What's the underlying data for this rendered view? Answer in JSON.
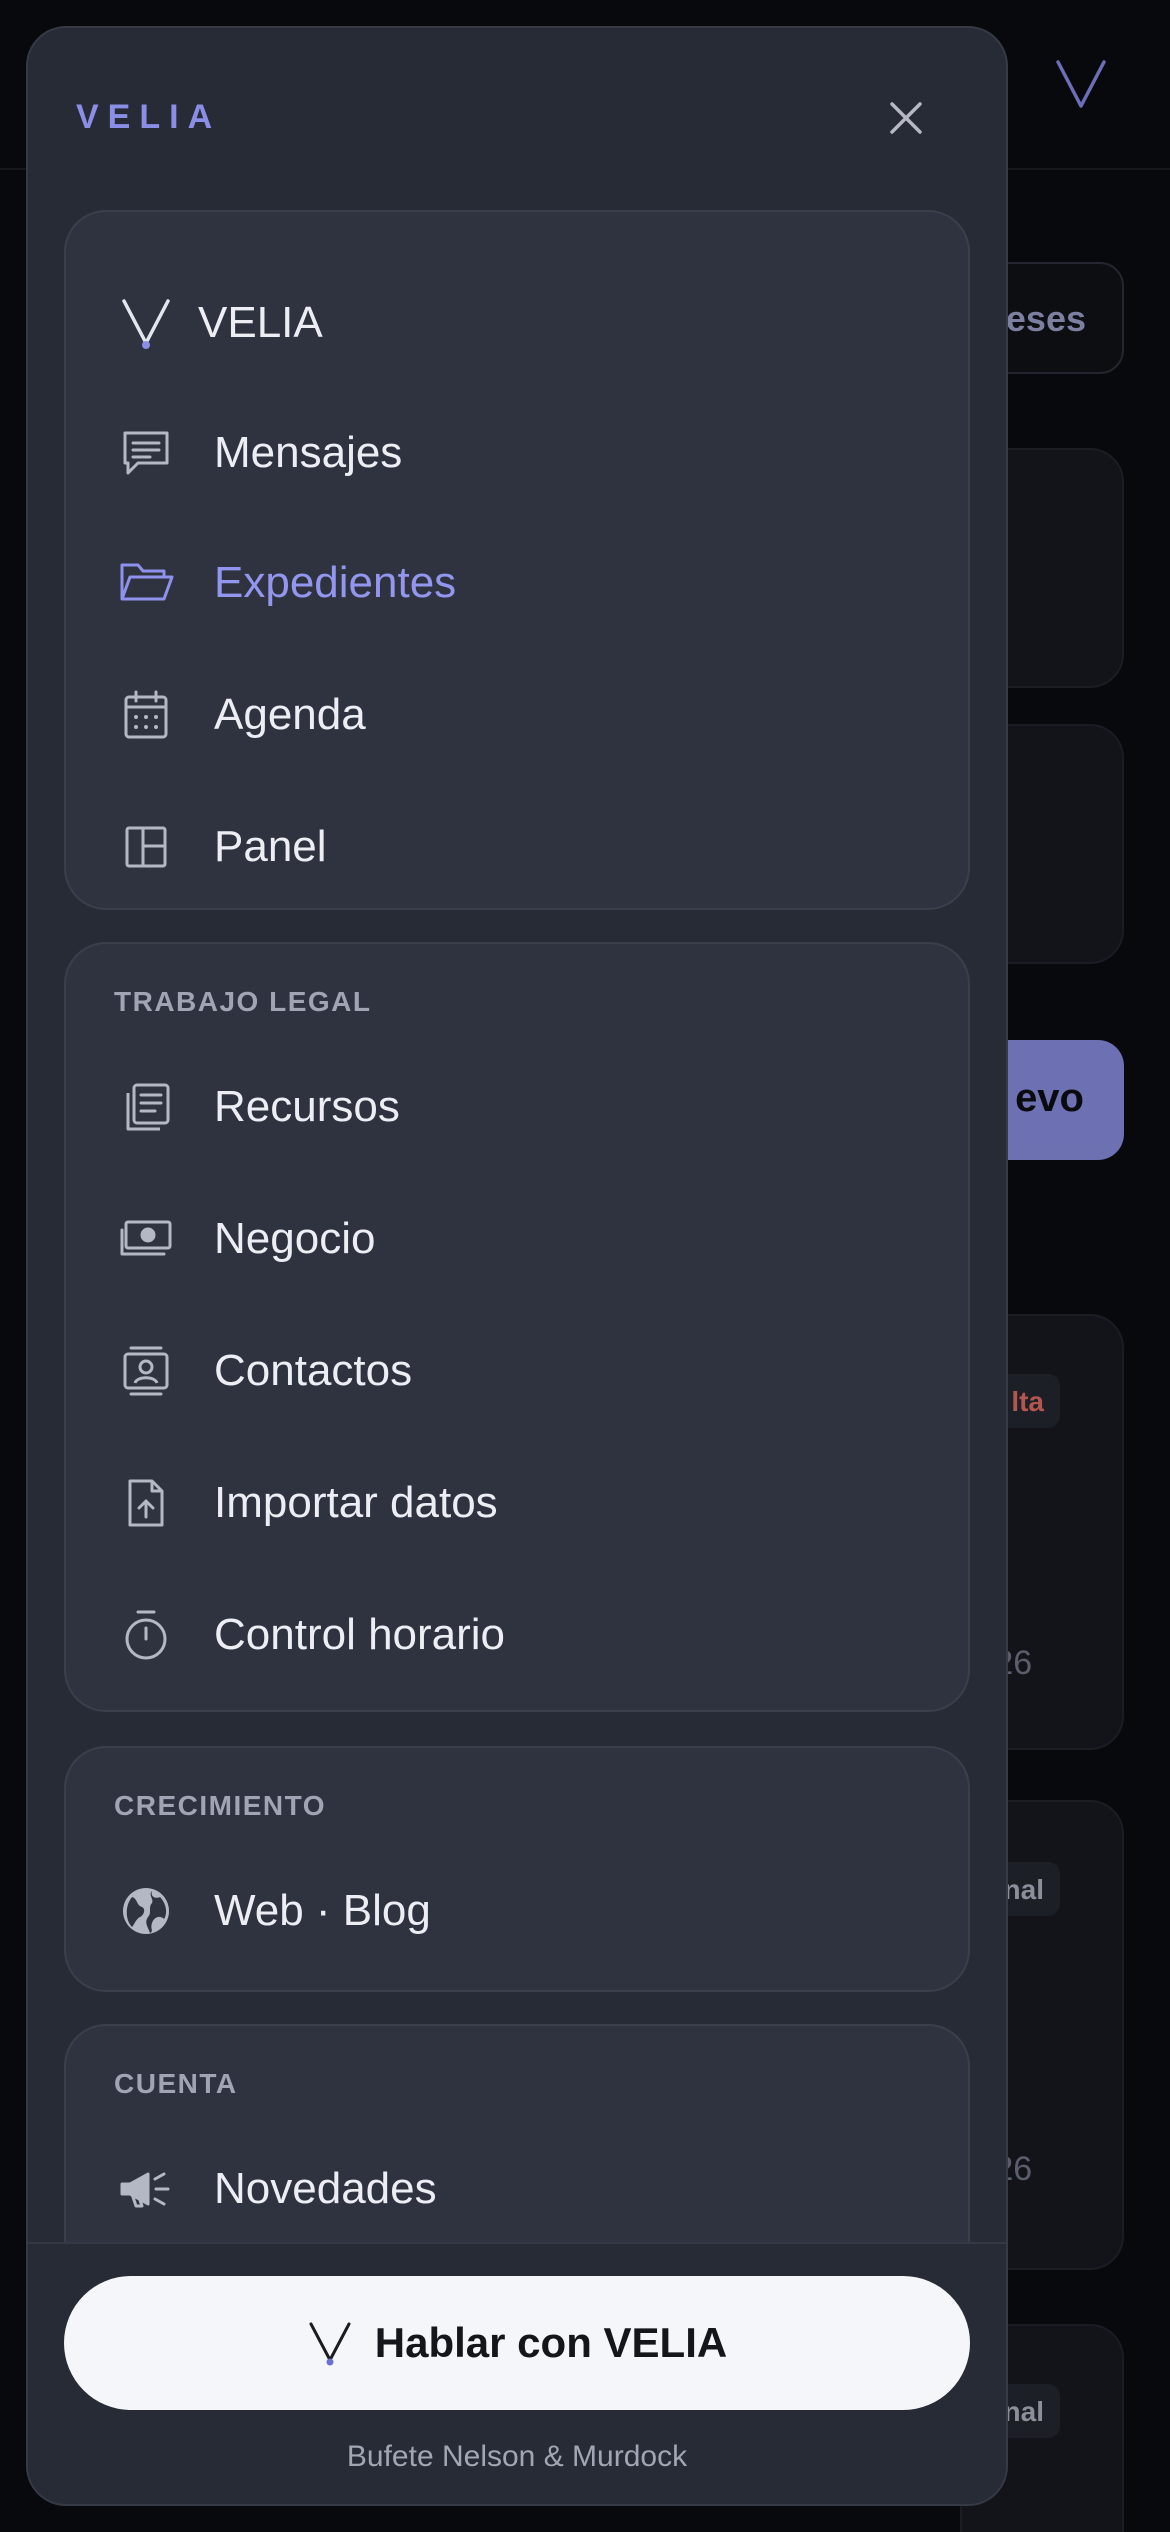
{
  "background": {
    "pill_label": "eses",
    "new_button_label": "evo",
    "cards": [
      {
        "badge": "lta",
        "badge_color": "#b2564f",
        "date": "n 26"
      },
      {
        "badge": "nal",
        "badge_color": "#8c8e99",
        "date": "n 26"
      },
      {
        "badge": "nal",
        "badge_color": "#8c8e99",
        "date": ""
      }
    ]
  },
  "drawer": {
    "brand": "VELIA",
    "close_icon": "close-icon",
    "main_group": {
      "items": [
        {
          "label": "VELIA",
          "icon": "velia-logo-icon"
        },
        {
          "label": "Mensajes",
          "icon": "chat-icon"
        },
        {
          "label": "Expedientes",
          "icon": "folder-open-icon",
          "active": true
        },
        {
          "label": "Agenda",
          "icon": "calendar-icon"
        },
        {
          "label": "Panel",
          "icon": "layout-panel-icon"
        }
      ]
    },
    "legal_group": {
      "title": "TRABAJO LEGAL",
      "items": [
        {
          "label": "Recursos",
          "icon": "documents-icon"
        },
        {
          "label": "Negocio",
          "icon": "money-icon"
        },
        {
          "label": "Contactos",
          "icon": "contact-card-icon"
        },
        {
          "label": "Importar datos",
          "icon": "file-upload-icon"
        },
        {
          "label": "Control horario",
          "icon": "stopwatch-icon"
        }
      ]
    },
    "growth_group": {
      "title": "CRECIMIENTO",
      "items": [
        {
          "label": "Web · Blog",
          "icon": "globe-icon"
        }
      ]
    },
    "account_group": {
      "title": "CUENTA",
      "items": [
        {
          "label": "Novedades",
          "icon": "megaphone-icon"
        }
      ]
    },
    "cta_label": "Hablar con VELIA",
    "firm_name": "Bufete Nelson & Murdock"
  },
  "colors": {
    "accent": "#8a8ee6",
    "active_label": "#9396ee",
    "drawer_bg": "#272b35",
    "group_bg": "#2f3340",
    "cta_bg": "#f5f6fa"
  }
}
